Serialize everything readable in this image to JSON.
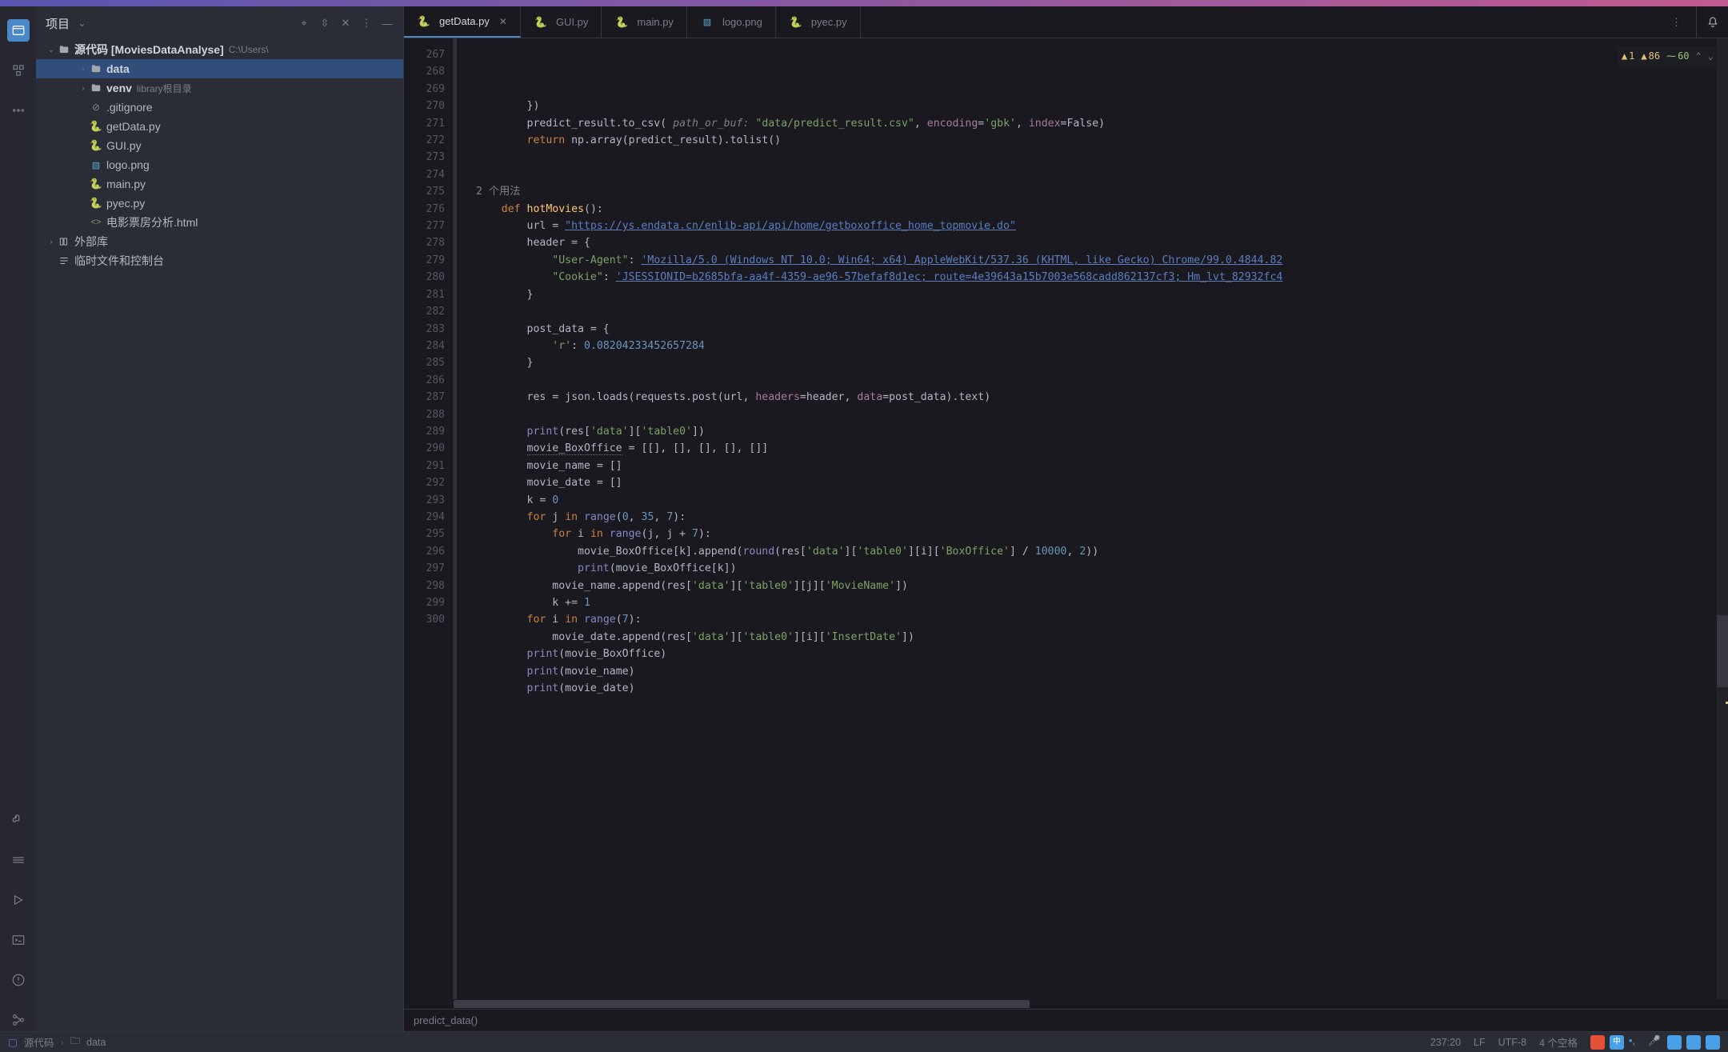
{
  "project_panel": {
    "title": "项目",
    "root_label": "源代码 [MoviesDataAnalyse]",
    "root_meta": "C:\\Users\\",
    "items": [
      {
        "name": "data",
        "type": "folder",
        "selected": true,
        "depth": 2
      },
      {
        "name": "venv",
        "type": "folder",
        "meta": "library根目录",
        "depth": 2
      },
      {
        "name": ".gitignore",
        "type": "ignore",
        "depth": 2
      },
      {
        "name": "getData.py",
        "type": "py",
        "depth": 2
      },
      {
        "name": "GUI.py",
        "type": "py",
        "depth": 2
      },
      {
        "name": "logo.png",
        "type": "img",
        "depth": 2
      },
      {
        "name": "main.py",
        "type": "py",
        "depth": 2
      },
      {
        "name": "pyec.py",
        "type": "py",
        "depth": 2
      },
      {
        "name": "电影票房分析.html",
        "type": "html",
        "depth": 2
      }
    ],
    "ext_lib": "外部库",
    "scratch": "临时文件和控制台"
  },
  "tabs": [
    {
      "label": "getData.py",
      "type": "py",
      "active": true
    },
    {
      "label": "GUI.py",
      "type": "py"
    },
    {
      "label": "main.py",
      "type": "py"
    },
    {
      "label": "logo.png",
      "type": "img"
    },
    {
      "label": "pyec.py",
      "type": "py"
    }
  ],
  "inspection": {
    "warn1": "1",
    "warn2": "86",
    "ok": "60"
  },
  "code": {
    "first_line": 267,
    "usages_text": "2 个用法",
    "lines": [
      "        })",
      "        predict_result.to_csv( §path_or_buf:§ ~\"data/predict_result.csv\"~, ¶encoding¶=~'gbk'~, ¶index¶=False)",
      "        ®return® np.array(predict_result).tolist()",
      "",
      "",
      "@USAGES@",
      "    ®def® ƒhotMoviesƒ():",
      "        url = ∞\"https://ys.endata.cn/enlib-api/api/home/getboxoffice_home_topmovie.do\"∞",
      "        header = {",
      "            ~\"User-Agent\"~: ∞'Mozilla/5.0 (Windows NT 10.0; Win64; x64) AppleWebKit/537.36 (KHTML, like Gecko) Chrome/99.0.4844.82∞",
      "            ~\"Cookie\"~: ∞'JSESSIONID=b2685bfa-aa4f-4359-ae96-57befaf8d1ec; route=4e39643a15b7003e568cadd862137cf3; Hm_lvt_82932fc4∞",
      "        }",
      "",
      "        post_data = {",
      "            ~'r'~: #0.08204233452657284#",
      "        }",
      "",
      "        res = json.loads(requests.post(url, ¶headers¶=header, ¶data¶=post_data).text)",
      "",
      "        ∫print∫(res[~'data'~][~'table0'~])",
      "        ↯movie_BoxOffice↯ = [[], [], [], [], []]",
      "        movie_name = []",
      "        movie_date = []",
      "        k = #0#",
      "        ®for® j ®in® ∫range∫(#0#, #35#, #7#):",
      "            ®for® i ®in® ∫range∫(j, j + #7#):",
      "                movie_BoxOffice[k].append(∫round∫(res[~'data'~][~'table0'~][i][~'BoxOffice'~] / #10000#, #2#))",
      "                ∫print∫(movie_BoxOffice[k])",
      "            movie_name.append(res[~'data'~][~'table0'~][j][~'MovieName'~])",
      "            k += #1#",
      "        ®for® i ®in® ∫range∫(#7#):",
      "            movie_date.append(res[~'data'~][~'table0'~][i][~'InsertDate'~])",
      "        ∫print∫(movie_BoxOffice)",
      "        ∫print∫(movie_name)",
      "        ∫print∫(movie_date)"
    ]
  },
  "breadcrumb_fn": "predict_data()",
  "status": {
    "breadcrumb": [
      "源代码",
      "data"
    ],
    "pos": "237:20",
    "eol": "LF",
    "enc": "UTF-8",
    "indent": "4 个空格"
  }
}
